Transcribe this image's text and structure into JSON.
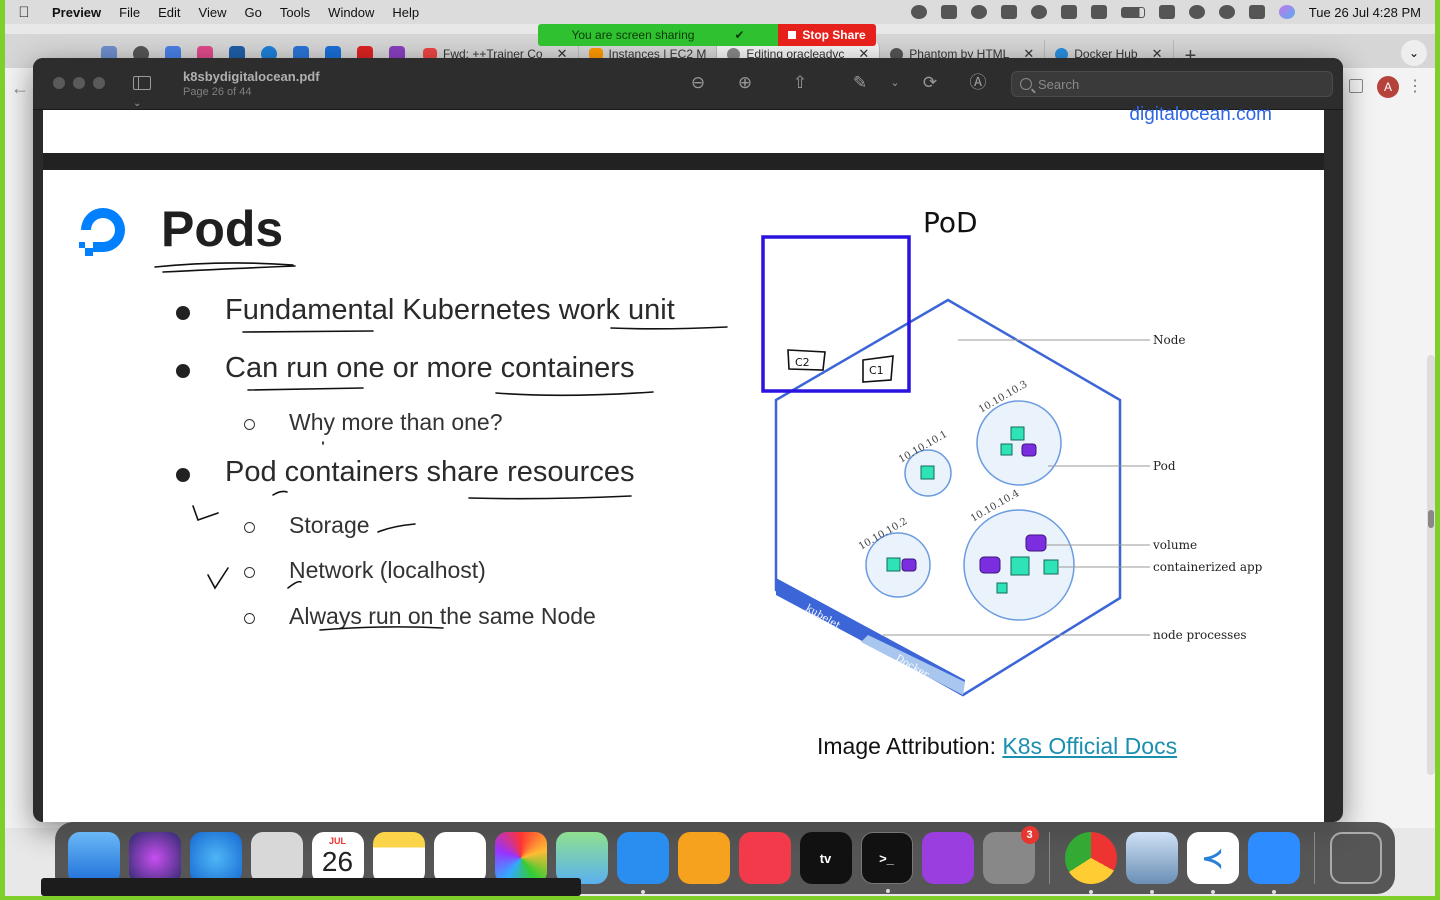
{
  "menubar": {
    "app": "Preview",
    "items": [
      "File",
      "Edit",
      "View",
      "Go",
      "Tools",
      "Window",
      "Help"
    ],
    "clock": "Tue 26 Jul  4:28 PM"
  },
  "screenshare": {
    "message": "You are screen sharing",
    "stop_label": "Stop Share"
  },
  "browser": {
    "tabs": [
      {
        "label": "Fwd: ++Trainer Co",
        "icon": "gmail-icon"
      },
      {
        "label": "Instances | EC2 M",
        "icon": "aws-icon"
      },
      {
        "label": "Editing oracleadvc",
        "icon": "wordpress-icon",
        "active": true
      },
      {
        "label": "Phantom by HTML",
        "icon": "globe-icon"
      },
      {
        "label": "Docker Hub",
        "icon": "docker-icon"
      }
    ],
    "new_tab": "+",
    "avatar": "A"
  },
  "preview": {
    "doc_title": "k8sbydigitalocean.pdf",
    "page_info": "Page 26 of 44",
    "search_placeholder": "Search",
    "prev_page_tail": "digitalocean.com"
  },
  "slide": {
    "title": "Pods",
    "bullets": [
      {
        "level": 1,
        "text": "Fundamental Kubernetes work unit"
      },
      {
        "level": 1,
        "text": "Can run one or more containers"
      },
      {
        "level": 2,
        "text": "Why more than one?"
      },
      {
        "level": 1,
        "text": "Pod containers share resources"
      },
      {
        "level": 2,
        "text": "Storage"
      },
      {
        "level": 2,
        "text": "Network (localhost)"
      },
      {
        "level": 2,
        "text": "Always run on the same Node"
      }
    ],
    "diagram": {
      "labels": {
        "node": "Node",
        "pod": "Pod",
        "volume": "volume",
        "app": "containerized app",
        "processes": "node processes"
      },
      "ips": [
        "10.10.10.3",
        "10.10.10.1",
        "10.10.10.4",
        "10.10.10.2"
      ],
      "band_kubelet": "kubelet",
      "band_docker": "Docker"
    },
    "attribution_prefix": "Image Attribution: ",
    "attribution_link": "K8s Official Docs",
    "handwriting": {
      "pod": "PoD",
      "c1": "C1",
      "c2": "C2"
    }
  },
  "dock": {
    "calendar_month": "JUL",
    "calendar_day": "26",
    "tv_label": "\u0000tv",
    "settings_badge": "3",
    "terminal_label": ">_"
  },
  "colors": {
    "accent_blue": "#2e66e6",
    "annotation_box": "#2a12e0",
    "pod_teal": "#2ee3b8",
    "volume_purple": "#7a2ee0",
    "node_line": "#3c66d8",
    "share_green": "#2fc12f",
    "stop_red": "#e6211c"
  }
}
